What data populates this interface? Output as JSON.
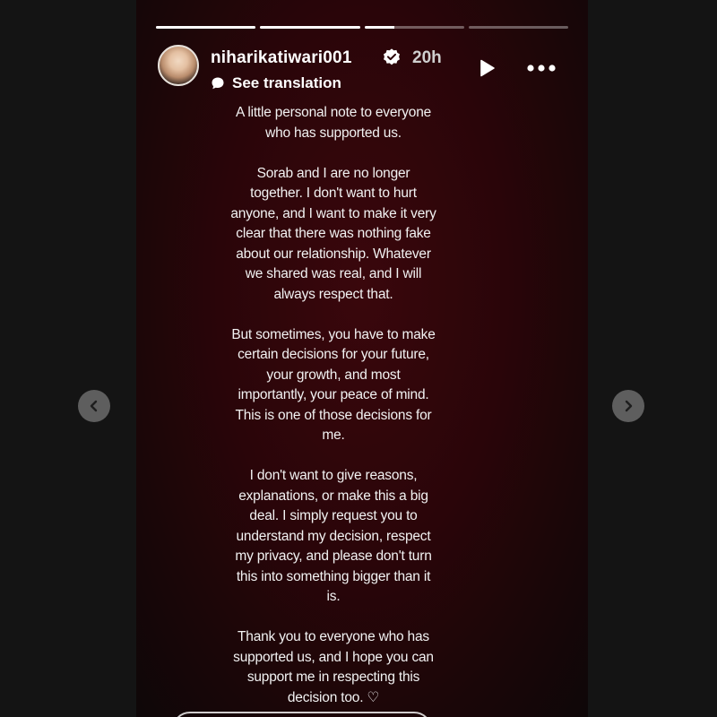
{
  "progress": [
    1,
    1,
    0.3,
    0
  ],
  "header": {
    "username": "niharikatiwari001",
    "time": "20h",
    "see_translation": "See translation"
  },
  "icons": {
    "verified": "verified-badge-icon",
    "translate": "speech-bubble-icon",
    "play": "play-icon",
    "more": "more-options-icon",
    "prev": "chevron-left-icon",
    "next": "chevron-right-icon",
    "heart": "heart-icon"
  },
  "note": {
    "paragraphs": [
      [
        "A little personal note to everyone",
        "who has supported us."
      ],
      [
        "Sorab and I are no longer",
        "together. I don't want to hurt",
        "anyone, and I want to make it very",
        "clear that there was nothing fake",
        "about our relationship. Whatever",
        "we shared was real, and I will",
        "always respect that."
      ],
      [
        "But sometimes, you have to make",
        "certain decisions for your future,",
        "your growth, and most",
        "importantly, your peace of mind.",
        "This is one of those decisions for",
        "me."
      ],
      [
        "I don't want to give reasons,",
        "explanations, or make this a big",
        "deal. I simply request you to",
        "understand my decision, respect",
        "my privacy, and please don't turn",
        "this into something bigger than it",
        "is."
      ],
      [
        "Thank you to everyone who has",
        "supported us, and I hope you can",
        "support me in respecting this",
        "decision too. ♡"
      ]
    ]
  },
  "colors": {
    "viewer_bg": "#141414",
    "story_bg": "#2a0509",
    "nav_button": "#5e5e5e"
  }
}
